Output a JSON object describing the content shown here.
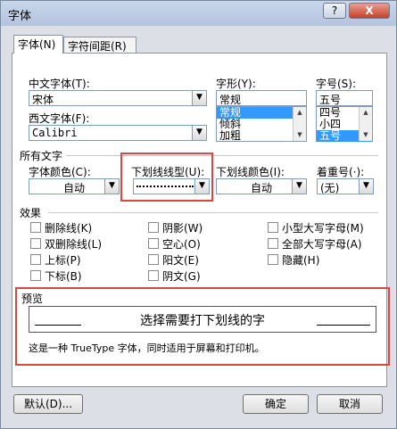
{
  "window": {
    "title": "字体",
    "help_label": "?",
    "close_label": "X"
  },
  "tabs": [
    {
      "label": "字体(N)"
    },
    {
      "label": "字符间距(R)"
    }
  ],
  "chinese_font": {
    "label": "中文字体(T):",
    "value": "宋体"
  },
  "western_font": {
    "label": "西文字体(F):",
    "value": "Calibri"
  },
  "style": {
    "label": "字形(Y):",
    "value": "常规",
    "options": [
      "常规",
      "倾斜",
      "加粗"
    ]
  },
  "size": {
    "label": "字号(S):",
    "value": "五号",
    "options": [
      "四号",
      "小四",
      "五号"
    ]
  },
  "all_text": {
    "label": "所有文字"
  },
  "font_color": {
    "label": "字体颜色(C):",
    "value": "自动"
  },
  "underline_type": {
    "label": "下划线线型(U):"
  },
  "underline_color": {
    "label": "下划线颜色(I):",
    "value": "自动"
  },
  "emphasis": {
    "label": "着重号(·):",
    "value": "(无)"
  },
  "effects": {
    "label": "效果",
    "items": [
      "删除线(K)",
      "阴影(W)",
      "小型大写字母(M)",
      "双删除线(L)",
      "空心(O)",
      "全部大写字母(A)",
      "上标(P)",
      "阳文(E)",
      "隐藏(H)",
      "下标(B)",
      "阴文(G)"
    ]
  },
  "preview": {
    "label": "预览",
    "sample": "选择需要打下划线的字",
    "note": "这是一种 TrueType 字体，同时适用于屏幕和打印机。"
  },
  "footer": {
    "default_label": "默认(D)...",
    "ok_label": "确定",
    "cancel_label": "取消"
  },
  "accent": "#d64848"
}
